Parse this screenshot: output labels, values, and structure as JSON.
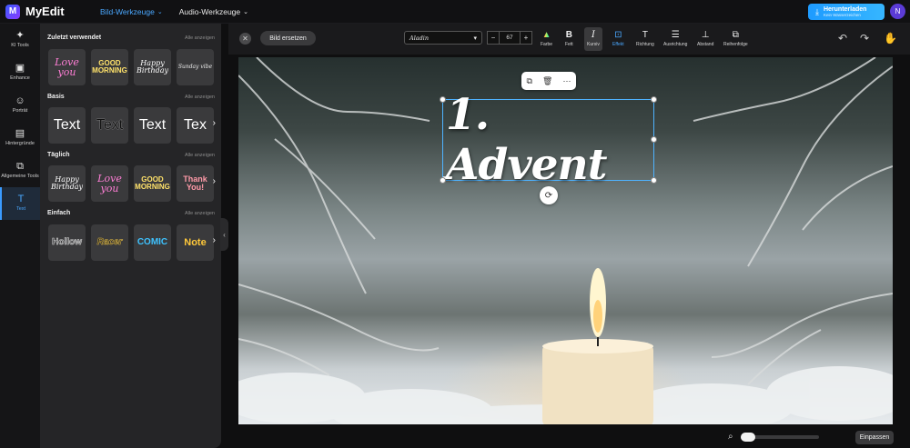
{
  "app": {
    "name": "MyEdit",
    "logo_letter": "M"
  },
  "nav": {
    "tools": "Bild-Werkzeuge",
    "audio": "Audio-Werkzeuge"
  },
  "download": {
    "label": "Herunterladen",
    "sub": "Kein Wasserzeichen"
  },
  "user": {
    "initial": "N"
  },
  "rail": [
    {
      "label": "KI Tools",
      "icon": "magic-wand-icon",
      "glyph": "✦"
    },
    {
      "label": "Enhance",
      "icon": "image-enhance-icon",
      "glyph": "▣"
    },
    {
      "label": "Porträt",
      "icon": "portrait-icon",
      "glyph": "☺"
    },
    {
      "label": "Hintergründe",
      "icon": "background-icon",
      "glyph": "▤"
    },
    {
      "label": "Allgemeine Tools",
      "icon": "general-tools-icon",
      "glyph": "⧉"
    },
    {
      "label": "Text",
      "icon": "text-icon",
      "glyph": "T"
    }
  ],
  "panel": {
    "show_all": "Alle anzeigen",
    "sections": [
      {
        "title": "Zuletzt verwendet",
        "tiles": [
          "Love you",
          "GOOD MORNING",
          "Happy Birthday",
          "Sunday vibe"
        ]
      },
      {
        "title": "Basis",
        "tiles": [
          "Text",
          "Text",
          "Text",
          "Tex"
        ]
      },
      {
        "title": "Täglich",
        "tiles": [
          "Happy Birthday",
          "Love you",
          "GOOD MORNING",
          "Thank You!"
        ]
      },
      {
        "title": "Einfach",
        "tiles": [
          "Hollow",
          "Racer",
          "COMIC",
          "Note"
        ]
      }
    ]
  },
  "toolbar": {
    "replace": "Bild ersetzen",
    "font": "Aladin",
    "size": "67",
    "tools": [
      "Farbe",
      "Fett",
      "Kursiv",
      "Effekt",
      "Richtung",
      "Ausrichtung",
      "Abstand",
      "Reihenfolge"
    ]
  },
  "canvas": {
    "text": "1. Advent"
  },
  "bottom": {
    "fit": "Einpassen"
  },
  "colors": {
    "accent": "#4aa8ff",
    "download": "#1e9bff",
    "avatar": "#5b3bd6"
  }
}
